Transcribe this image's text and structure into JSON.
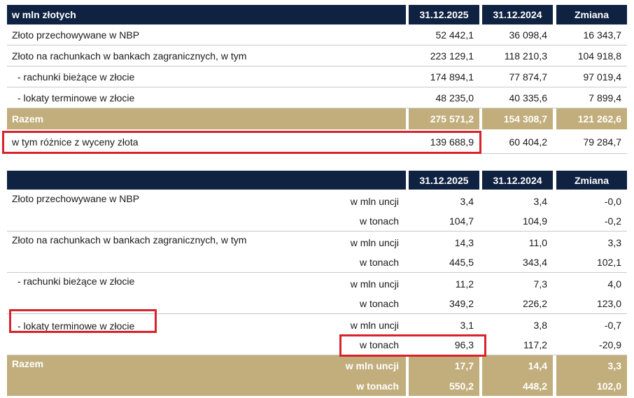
{
  "table1": {
    "header": {
      "label": "w mln złotych",
      "col1": "31.12.2025",
      "col2": "31.12.2024",
      "col3": "Zmiana"
    },
    "rows": [
      {
        "label": "Złoto przechowywane w NBP",
        "v1": "52 442,1",
        "v2": "36 098,4",
        "v3": "16 343,7"
      },
      {
        "label": "Złoto na rachunkach w bankach zagranicznych, w tym",
        "v1": "223 129,1",
        "v2": "118 210,3",
        "v3": "104 918,8"
      },
      {
        "label": "- rachunki bieżące w złocie",
        "v1": "174 894,1",
        "v2": "77 874,7",
        "v3": "97 019,4"
      },
      {
        "label": "- lokaty terminowe w złocie",
        "v1": "48 235,0",
        "v2": "40 335,6",
        "v3": "7 899,4"
      }
    ],
    "total": {
      "label": "Razem",
      "v1": "275 571,2",
      "v2": "154 308,7",
      "v3": "121 262,6"
    },
    "extra": {
      "label": "w tym różnice z wyceny złota",
      "v1": "139 688,9",
      "v2": "60 404,2",
      "v3": "79 284,7"
    }
  },
  "table2": {
    "header": {
      "label": "",
      "col1": "31.12.2025",
      "col2": "31.12.2024",
      "col3": "Zmiana"
    },
    "groups": [
      {
        "label": "Złoto przechowywane w NBP",
        "rows": [
          {
            "unit": "w mln uncji",
            "v1": "3,4",
            "v2": "3,4",
            "v3": "-0,0"
          },
          {
            "unit": "w tonach",
            "v1": "104,7",
            "v2": "104,9",
            "v3": "-0,2"
          }
        ]
      },
      {
        "label": "Złoto na rachunkach w bankach zagranicznych, w tym",
        "rows": [
          {
            "unit": "w mln uncji",
            "v1": "14,3",
            "v2": "11,0",
            "v3": "3,3"
          },
          {
            "unit": "w tonach",
            "v1": "445,5",
            "v2": "343,4",
            "v3": "102,1"
          }
        ]
      },
      {
        "label": "- rachunki bieżące w złocie",
        "rows": [
          {
            "unit": "w mln uncji",
            "v1": "11,2",
            "v2": "7,3",
            "v3": "4,0"
          },
          {
            "unit": "w tonach",
            "v1": "349,2",
            "v2": "226,2",
            "v3": "123,0"
          }
        ]
      },
      {
        "label": "- lokaty terminowe w złocie",
        "rows": [
          {
            "unit": "w mln uncji",
            "v1": "3,1",
            "v2": "3,8",
            "v3": "-0,7"
          },
          {
            "unit": "w tonach",
            "v1": "96,3",
            "v2": "117,2",
            "v3": "-20,9"
          }
        ]
      }
    ],
    "total": {
      "label": "Razem",
      "rows": [
        {
          "unit": "w mln uncji",
          "v1": "17,7",
          "v2": "14,4",
          "v3": "3,3"
        },
        {
          "unit": "w tonach",
          "v1": "550,2",
          "v2": "448,2",
          "v3": "102,0"
        }
      ]
    }
  },
  "colors": {
    "header_bg": "#0f2242",
    "total_bg": "#c2ae7c",
    "highlight": "#d8232a"
  }
}
